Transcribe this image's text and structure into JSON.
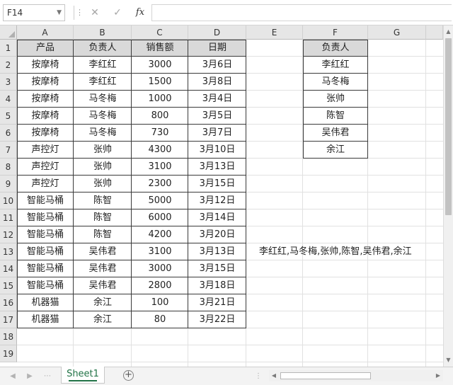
{
  "formula_bar": {
    "name_box": "F14",
    "cancel_icon": "✕",
    "enter_icon": "✓",
    "fx_label": "fx",
    "formula": ""
  },
  "columns": [
    "A",
    "B",
    "C",
    "D",
    "E",
    "F",
    "G"
  ],
  "rows": [
    "1",
    "2",
    "3",
    "4",
    "5",
    "6",
    "7",
    "8",
    "9",
    "10",
    "11",
    "12",
    "13",
    "14",
    "15",
    "16",
    "17",
    "18",
    "19"
  ],
  "table": {
    "headers": [
      "产品",
      "负责人",
      "销售额",
      "日期"
    ],
    "rows": [
      [
        "按摩椅",
        "李红红",
        "3000",
        "3月6日"
      ],
      [
        "按摩椅",
        "李红红",
        "1500",
        "3月8日"
      ],
      [
        "按摩椅",
        "马冬梅",
        "1000",
        "3月4日"
      ],
      [
        "按摩椅",
        "马冬梅",
        "800",
        "3月5日"
      ],
      [
        "按摩椅",
        "马冬梅",
        "730",
        "3月7日"
      ],
      [
        "声控灯",
        "张帅",
        "4300",
        "3月10日"
      ],
      [
        "声控灯",
        "张帅",
        "3100",
        "3月13日"
      ],
      [
        "声控灯",
        "张帅",
        "2300",
        "3月15日"
      ],
      [
        "智能马桶",
        "陈智",
        "5000",
        "3月12日"
      ],
      [
        "智能马桶",
        "陈智",
        "6000",
        "3月14日"
      ],
      [
        "智能马桶",
        "陈智",
        "4200",
        "3月20日"
      ],
      [
        "智能马桶",
        "吴伟君",
        "3100",
        "3月13日"
      ],
      [
        "智能马桶",
        "吴伟君",
        "3000",
        "3月15日"
      ],
      [
        "智能马桶",
        "吴伟君",
        "2800",
        "3月18日"
      ],
      [
        "机器猫",
        "余江",
        "100",
        "3月21日"
      ],
      [
        "机器猫",
        "余江",
        "80",
        "3月22日"
      ]
    ]
  },
  "owner_list": {
    "header": "负责人",
    "items": [
      "李红红",
      "马冬梅",
      "张帅",
      "陈智",
      "吴伟君",
      "余江"
    ]
  },
  "result_text": "李红红,马冬梅,张帅,陈智,吴伟君,余江",
  "sheet_tabs": [
    "Sheet1"
  ],
  "add_sheet_icon": "+",
  "colors": {
    "header_fill": "#d9d9d9",
    "tab_accent": "#217346",
    "gridline": "#e1e1e1"
  }
}
